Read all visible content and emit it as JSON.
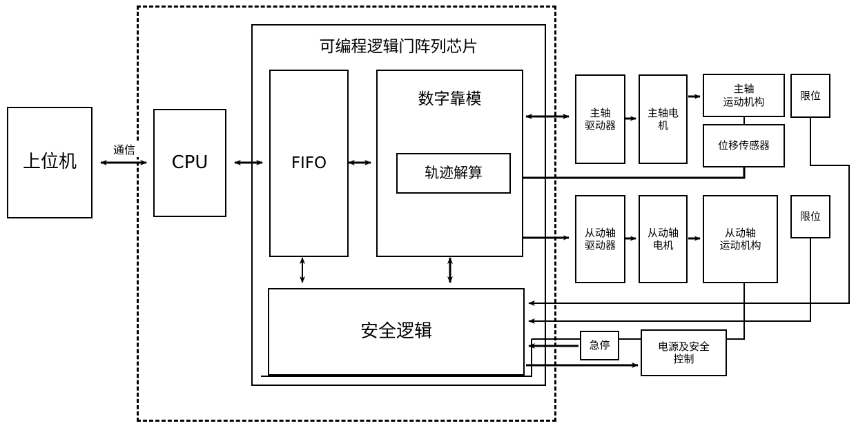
{
  "diagram": {
    "title_fpga": "可编程逻辑门阵列芯片",
    "labels": {
      "host": "上位机",
      "cpu": "CPU",
      "comm": "通信",
      "fifo": "FIFO",
      "digital_profiling": "数字靠模",
      "trajectory_solver": "轨迹解算",
      "safety_logic": "安全逻辑",
      "spindle_driver": "主轴\n驱动器",
      "spindle_driver_l1": "主轴",
      "spindle_driver_l2": "驱动器",
      "spindle_motor_l1": "主轴电",
      "spindle_motor_l2": "机",
      "spindle_mechanism_l1": "主轴",
      "spindle_mechanism_l2": "运动机构",
      "displacement_sensor": "位移传感器",
      "limit_switch_1": "限位",
      "limit_switch_2": "限位",
      "slave_driver_l1": "从动轴",
      "slave_driver_l2": "驱动器",
      "slave_motor_l1": "从动轴",
      "slave_motor_l2": "电机",
      "slave_mechanism_l1": "从动轴",
      "slave_mechanism_l2": "运动机构",
      "emergency_stop": "急停",
      "power_safety_l1": "电源及安全",
      "power_safety_l2": "控制"
    },
    "colors": {
      "stroke": "#000000",
      "fill": "#ffffff"
    }
  }
}
